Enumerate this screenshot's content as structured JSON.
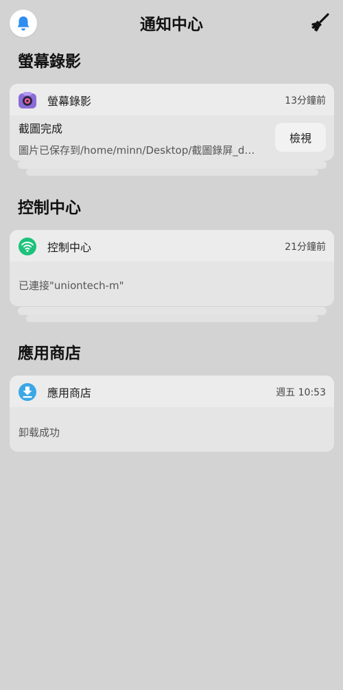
{
  "header": {
    "title": "通知中心",
    "bell_icon": "bell-icon",
    "clear_icon": "broom-icon"
  },
  "groups": [
    {
      "title": "螢幕錄影",
      "notification": {
        "app_name": "螢幕錄影",
        "icon": "camera-icon",
        "time": "13分鐘前",
        "summary": "截圖完成",
        "body": "圖片已保存到/home/minn/Desktop/截圖錄屏_d…",
        "action": "檢視"
      }
    },
    {
      "title": "控制中心",
      "notification": {
        "app_name": "控制中心",
        "icon": "wifi-icon",
        "time": "21分鐘前",
        "body": "已連接\"uniontech-m\""
      }
    },
    {
      "title": "應用商店",
      "notification": {
        "app_name": "應用商店",
        "icon": "download-icon",
        "time": "週五 10:53",
        "body": "卸载成功"
      }
    }
  ],
  "colors": {
    "background": "#d3d3d3",
    "card": "#e5e5e5",
    "bell_blue": "#2f8cf0",
    "wifi_green": "#1cc27a",
    "store_blue": "#3aa8e6",
    "camera_purple": "#8a6cd8"
  }
}
